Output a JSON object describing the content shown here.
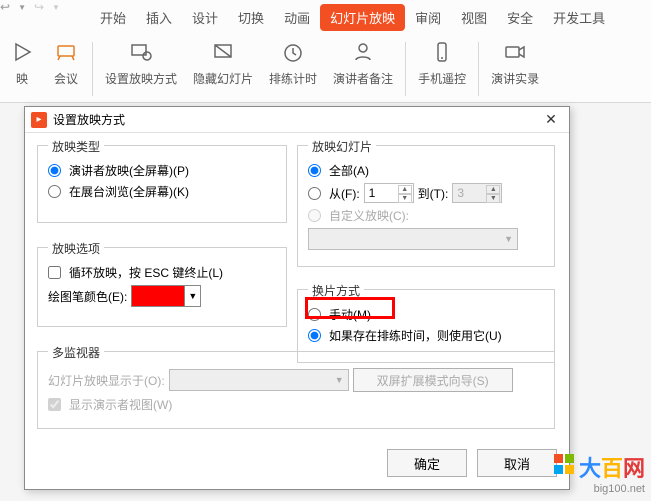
{
  "tabs": {
    "start": "开始",
    "insert": "插入",
    "design": "设计",
    "transition": "切换",
    "animation": "动画",
    "slideshow": "幻灯片放映",
    "review": "审阅",
    "view": "视图",
    "security": "安全",
    "devtools": "开发工具"
  },
  "ribbon": {
    "play": "映",
    "meeting": "会议",
    "setup": "设置放映方式",
    "hide": "隐藏幻灯片",
    "rehearse": "排练计时",
    "notes": "演讲者备注",
    "mobile": "手机遥控",
    "record": "演讲实录"
  },
  "dialog": {
    "title": "设置放映方式",
    "type_group": "放映类型",
    "type_presenter": "演讲者放映(全屏幕)(P)",
    "type_browse": "在展台浏览(全屏幕)(K)",
    "options_group": "放映选项",
    "loop": "循环放映，按 ESC 键终止(L)",
    "pen_color": "绘图笔颜色(E):",
    "slides_group": "放映幻灯片",
    "all": "全部(A)",
    "from": "从(F):",
    "from_val": "1",
    "to": "到(T):",
    "to_val": "3",
    "custom": "自定义放映(C):",
    "advance_group": "换片方式",
    "manual": "手动(M)",
    "timings": "如果存在排练时间，则使用它(U)",
    "monitor_group": "多监视器",
    "display_on": "幻灯片放映显示于(O):",
    "dual_btn": "双屏扩展模式向导(S)",
    "presenter_view": "显示演示者视图(W)",
    "ok": "确定",
    "cancel": "取消"
  },
  "watermark": {
    "chars": [
      "大",
      "百",
      "网"
    ],
    "colors": [
      "#2e8bff",
      "#ffb400",
      "#e33a3a"
    ],
    "sub": "big100.net"
  }
}
